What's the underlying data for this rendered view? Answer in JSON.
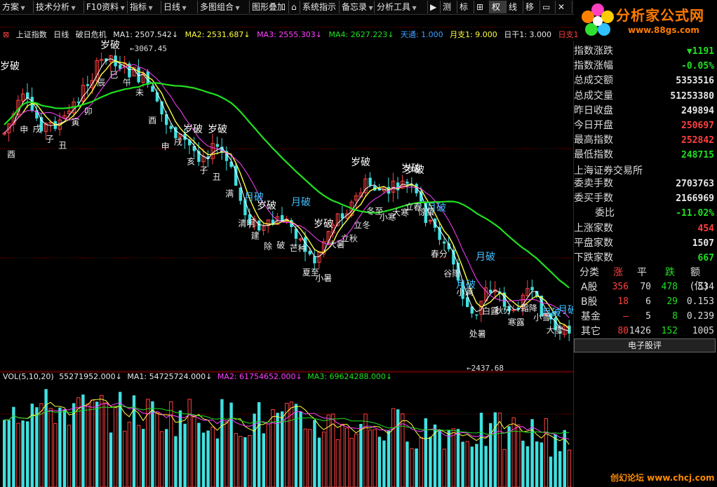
{
  "toolbar": {
    "items": [
      "方案",
      "技术分析",
      "F10资料",
      "指标",
      "日线",
      "多图组合",
      "图形叠加",
      "系统指示",
      "备忘录",
      "分析工具",
      "测",
      "标",
      "权",
      "线",
      "移"
    ],
    "active_item": "权"
  },
  "logo": {
    "title": "分析家公式网",
    "url": "www.88gs.com"
  },
  "infoline": {
    "index_name": "上证指数",
    "period": "日线",
    "indicator": "破日危机",
    "ma1": "MA1: 2507.542↓",
    "ma2": "MA2: 2531.687↓",
    "ma3": "MA3: 2555.303↓",
    "ma4": "MA4: 2627.223↓",
    "extra1": "天通: 1.000",
    "extra2": "月支1: 9.000",
    "extra3": "日干1: 3.000",
    "extra4": "日支1"
  },
  "chart_labels": {
    "high": "3067.45",
    "low": "2437.68"
  },
  "chart_annotations": {
    "big": [
      "岁破",
      "岁破",
      "岁破",
      "岁破",
      "岁破",
      "岁破",
      "岁破",
      "岁破",
      "月破",
      "月破",
      "月破",
      "月破",
      "月破",
      "月破",
      "岁破",
      "月破"
    ],
    "small": [
      "酉",
      "申",
      "戌",
      "子",
      "丑",
      "寅",
      "卯",
      "辰",
      "巳",
      "午",
      "未",
      "酉",
      "申",
      "戌",
      "亥",
      "子",
      "丑",
      "满",
      "清明",
      "建",
      "除",
      "破",
      "芒种",
      "夏至",
      "小暑",
      "大暑",
      "立秋",
      "立冬",
      "冬至",
      "小寒",
      "大寒",
      "立春",
      "惊蛰",
      "春分",
      "谷雨",
      "小满",
      "处暑",
      "白露",
      "秋分",
      "寒露",
      "霜降",
      "小雪",
      "大雪"
    ]
  },
  "volume": {
    "title": "VOL(5,10,20)",
    "vol": "55271952.000↓",
    "ma1": "MA1: 54725724.000↓",
    "ma2": "MA2: 61754652.000↓",
    "ma3": "MA3: 69624288.000↓"
  },
  "panel": {
    "rows": [
      {
        "label": "指数涨跌",
        "value": "▼1191",
        "color": "green"
      },
      {
        "label": "指数涨幅",
        "value": "-0.05%",
        "color": "green"
      },
      {
        "label": "总成交额",
        "value": "5353516",
        "color": "white"
      },
      {
        "label": "总成交量",
        "value": "51253380",
        "color": "white"
      },
      {
        "label": "昨日收盘",
        "value": "249894",
        "color": "white"
      },
      {
        "label": "今日开盘",
        "value": "250697",
        "color": "red"
      },
      {
        "label": "最高指数",
        "value": "252842",
        "color": "red"
      },
      {
        "label": "最低指数",
        "value": "248715",
        "color": "green"
      }
    ],
    "exchange": "上海证券交易所",
    "rows2": [
      {
        "label": "委卖手数",
        "value": "2703763",
        "color": "white"
      },
      {
        "label": "委买手数",
        "value": "2166969",
        "color": "white"
      },
      {
        "label": "委比",
        "value": "-11.02%",
        "color": "green"
      },
      {
        "label": "上涨家数",
        "value": "454",
        "color": "red"
      },
      {
        "label": "平盘家数",
        "value": "1507",
        "color": "white"
      },
      {
        "label": "下跌家数",
        "value": "667",
        "color": "green"
      }
    ],
    "sector_headers": [
      "分类",
      "涨",
      "平",
      "跌",
      "额(亿)"
    ],
    "sectors": [
      {
        "name": "A股",
        "up": "356",
        "flat": "70",
        "down": "478",
        "amt": "534"
      },
      {
        "name": "B股",
        "up": "18",
        "flat": "6",
        "down": "29",
        "amt": "0.153"
      },
      {
        "name": "基金",
        "up": "–",
        "flat": "5",
        "down": "8",
        "amt": "0.239"
      },
      {
        "name": "其它",
        "up": "80",
        "flat": "1426",
        "down": "152",
        "amt": "1005"
      }
    ],
    "board": "电子股评"
  },
  "footer": "创幻论坛 www.chcj.com",
  "colors": {
    "up": "#ff4040",
    "down": "#40e0e0",
    "ma1": "#ffffff",
    "ma2": "#ffff40",
    "ma3": "#ff40ff",
    "ma4": "#20e020",
    "grid": "#8a0000"
  }
}
